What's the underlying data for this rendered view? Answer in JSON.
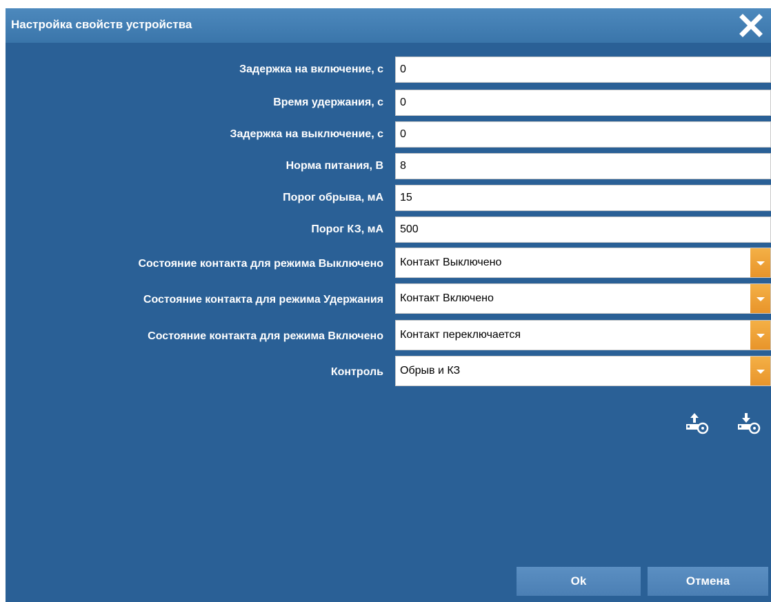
{
  "dialog": {
    "title": "Настройка свойств устройства"
  },
  "fields": [
    {
      "label": "Задержка на включение, с",
      "value": "0"
    },
    {
      "label": "Время удержания, с",
      "value": "0"
    },
    {
      "label": "Задержка на выключение, с",
      "value": "0"
    },
    {
      "label": "Норма питания, В",
      "value": "8"
    },
    {
      "label": "Порог обрыва, мА",
      "value": "15"
    },
    {
      "label": "Порог КЗ, мА",
      "value": "500"
    }
  ],
  "selects": [
    {
      "label": "Состояние контакта для режима Выключено",
      "value": "Контакт Выключено"
    },
    {
      "label": "Состояние контакта для режима Удержания",
      "value": "Контакт Включено"
    },
    {
      "label": "Состояние контакта для режима Включено",
      "value": "Контакт переключается"
    },
    {
      "label": "Контроль",
      "value": "Обрыв и КЗ"
    }
  ],
  "icons": {
    "upload": "upload-to-device-icon",
    "download": "download-from-device-icon",
    "close": "close-icon"
  },
  "buttons": {
    "ok": "Ok",
    "cancel": "Отмена"
  },
  "colors": {
    "dialog_bg": "#2a6096",
    "titlebar": "#3f7ab0",
    "dropdown_accent": "#eda035",
    "button": "#5386ba"
  }
}
